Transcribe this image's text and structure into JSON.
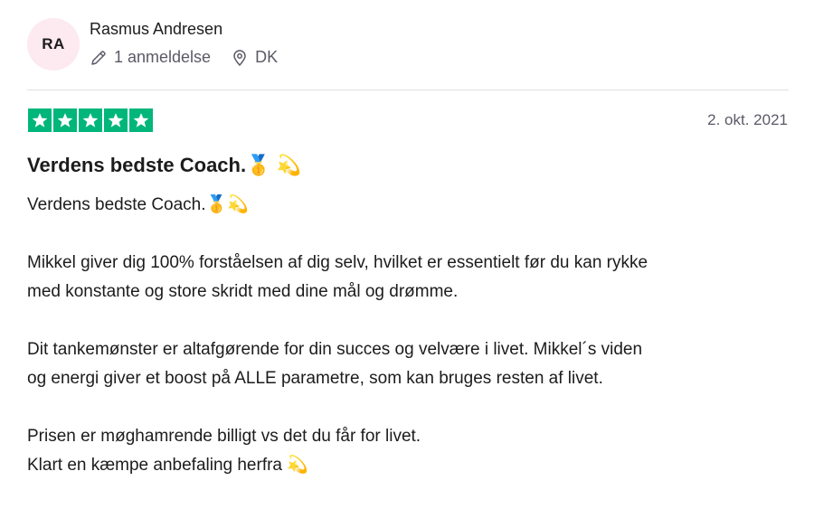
{
  "reviewer": {
    "initials": "RA",
    "name": "Rasmus Andresen",
    "reviews_count": "1 anmeldelse",
    "country": "DK",
    "avatar_bg": "#fde9f0"
  },
  "review": {
    "rating": 5,
    "star_color": "#00b67a",
    "date": "2. okt. 2021",
    "title": "Verdens bedste Coach.🥇 💫",
    "paragraphs": [
      [
        "Verdens bedste Coach.🥇💫"
      ],
      [
        "Mikkel giver dig 100% forståelsen af dig selv, hvilket er essentielt før du kan rykke",
        "med konstante og store skridt med dine mål og drømme."
      ],
      [
        "Dit tankemønster er altafgørende for din succes og velvære i livet. Mikkel´s viden",
        "og energi giver et boost på ALLE parametre, som kan bruges resten af livet."
      ],
      [
        "Prisen er møghamrende billigt vs det du får for livet.",
        "Klart en kæmpe anbefaling herfra 💫"
      ]
    ]
  },
  "icons": {
    "pencil": "pencil-icon",
    "location": "location-pin-icon",
    "star": "star-icon"
  }
}
